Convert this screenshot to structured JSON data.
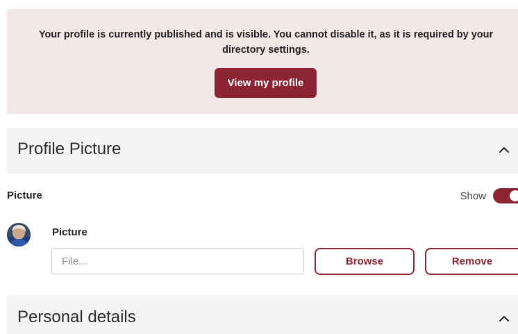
{
  "notice": {
    "message": "Your profile is currently published and is visible. You cannot disable it, as it is required by your directory settings.",
    "view_profile_label": "View my profile"
  },
  "profile_picture_section": {
    "title": "Profile Picture",
    "collapse_icon": "chevron-up-icon",
    "field_label": "Picture",
    "show_label": "Show",
    "show_toggle_on": true,
    "picture_label": "Picture",
    "file_input": {
      "value": "",
      "placeholder": "File..."
    },
    "browse_label": "Browse",
    "remove_label": "Remove"
  },
  "personal_details_section": {
    "title": "Personal details",
    "collapse_icon": "chevron-up-icon"
  },
  "colors": {
    "accent": "#8c2433",
    "notice_bg": "#f3e7e8",
    "section_bg": "#f5f4f3"
  }
}
